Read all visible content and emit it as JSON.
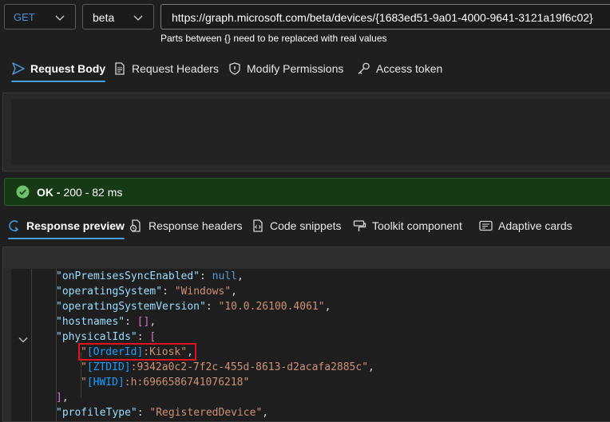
{
  "request": {
    "method": "GET",
    "version": "beta",
    "url": "https://graph.microsoft.com/beta/devices/{1683ed51-9a01-4000-9641-3121a19f6c02}",
    "hint": "Parts between {} need to be replaced with real values"
  },
  "request_tabs": [
    {
      "label": "Request Body",
      "icon": "send-icon",
      "active": true
    },
    {
      "label": "Request Headers",
      "icon": "document-icon",
      "active": false
    },
    {
      "label": "Modify Permissions",
      "icon": "shield-icon",
      "active": false
    },
    {
      "label": "Access token",
      "icon": "key-icon",
      "active": false
    }
  ],
  "status": {
    "label": "OK -",
    "detail": " 200 - 82 ms",
    "color": "#163a16",
    "icon": "checkmark-circle-icon"
  },
  "response_tabs": [
    {
      "label": "Response preview",
      "icon": "response-preview-icon",
      "active": true
    },
    {
      "label": "Response headers",
      "icon": "response-headers-icon",
      "active": false
    },
    {
      "label": "Code snippets",
      "icon": "code-snippets-icon",
      "active": false
    },
    {
      "label": "Toolkit component",
      "icon": "toolkit-icon",
      "active": false
    },
    {
      "label": "Adaptive cards",
      "icon": "adaptive-cards-icon",
      "active": false
    }
  ],
  "response_json": {
    "l1_key": "\"onPremisesSyncEnabled\"",
    "l1_val": "null",
    "l2_key": "\"operatingSystem\"",
    "l2_val": "\"Windows\"",
    "l3_key": "\"operatingSystemVersion\"",
    "l3_val": "\"10.0.26100.4061\"",
    "l4_key": "\"hostnames\"",
    "l4_val": "[]",
    "l5_key": "\"physicalIds\"",
    "l5_val": "[",
    "l6_q": "\"",
    "l6_tag": "[OrderId]",
    "l6_rest": ":Kiosk\"",
    "l7_q": "\"",
    "l7_tag": "[ZTDID]",
    "l7_rest": ":9342a0c2-7f2c-455d-8613-d2acafa2885c\"",
    "l8_q": "\"",
    "l8_tag": "[HWID]",
    "l8_rest": ":h:6966586741076218\"",
    "l9": "]",
    "l10_key": "\"profileType\"",
    "l10_val": "\"RegisteredDevice\"",
    "colon": ": ",
    "comma": ","
  },
  "colors": {
    "accent": "#4a9fe0",
    "highlight_box": "#e0141e"
  }
}
